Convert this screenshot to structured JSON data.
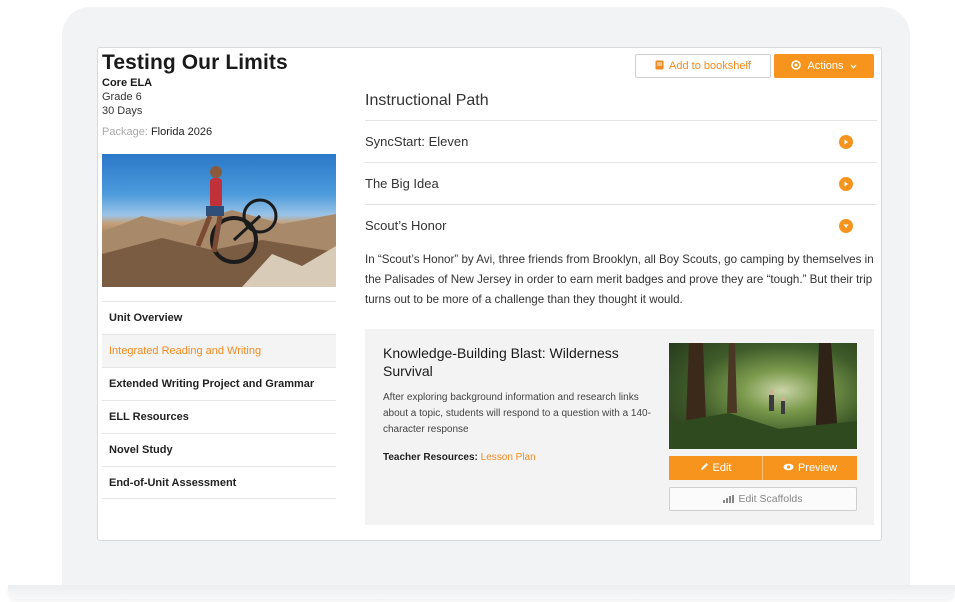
{
  "unit": {
    "title": "Testing Our Limits",
    "subject": "Core ELA",
    "grade": "Grade 6",
    "duration": "30 Days",
    "package_label": "Package:",
    "package_value": "Florida 2026"
  },
  "header": {
    "bookshelf_label": "Add to bookshelf",
    "actions_label": "Actions"
  },
  "sidebar": {
    "items": [
      {
        "label": "Unit Overview"
      },
      {
        "label": "Integrated Reading and Writing"
      },
      {
        "label": "Extended Writing Project and Grammar"
      },
      {
        "label": "ELL Resources"
      },
      {
        "label": "Novel Study"
      },
      {
        "label": "End-of-Unit Assessment"
      }
    ],
    "active_index": 1
  },
  "path": {
    "title": "Instructional Path",
    "items": [
      {
        "label": "SyncStart: Eleven",
        "state": "collapsed"
      },
      {
        "label": "The Big Idea",
        "state": "collapsed"
      },
      {
        "label": "Scout’s Honor",
        "state": "expanded"
      }
    ],
    "expanded_description": "In “Scout’s Honor” by Avi, three friends from Brooklyn, all Boy Scouts, go camping by themselves in the Palisades of New Jersey in order to earn merit badges and prove they are “tough.” But their trip turns out to be more of a challenge than they thought it would."
  },
  "card": {
    "title": "Knowledge-Building Blast: Wilderness Survival",
    "description": "After exploring background information and research links about a topic, students will respond to a question with a 140-character response",
    "resources_label": "Teacher Resources:",
    "resources_link": "Lesson Plan",
    "edit_label": "Edit",
    "preview_label": "Preview",
    "scaffolds_label": "Edit Scaffolds"
  },
  "colors": {
    "accent": "#f7941d",
    "active_link": "#f48a1f",
    "card_bg": "#f3f3f3"
  },
  "icons": {
    "bookshelf": "book-icon",
    "actions": "gear-icon",
    "actions_caret": "chevron-down-icon",
    "path_collapsed": "chevron-right-circle-icon",
    "path_expanded": "chevron-down-circle-icon",
    "edit": "pencil-icon",
    "preview": "eye-icon",
    "scaffolds": "bar-chart-icon"
  }
}
